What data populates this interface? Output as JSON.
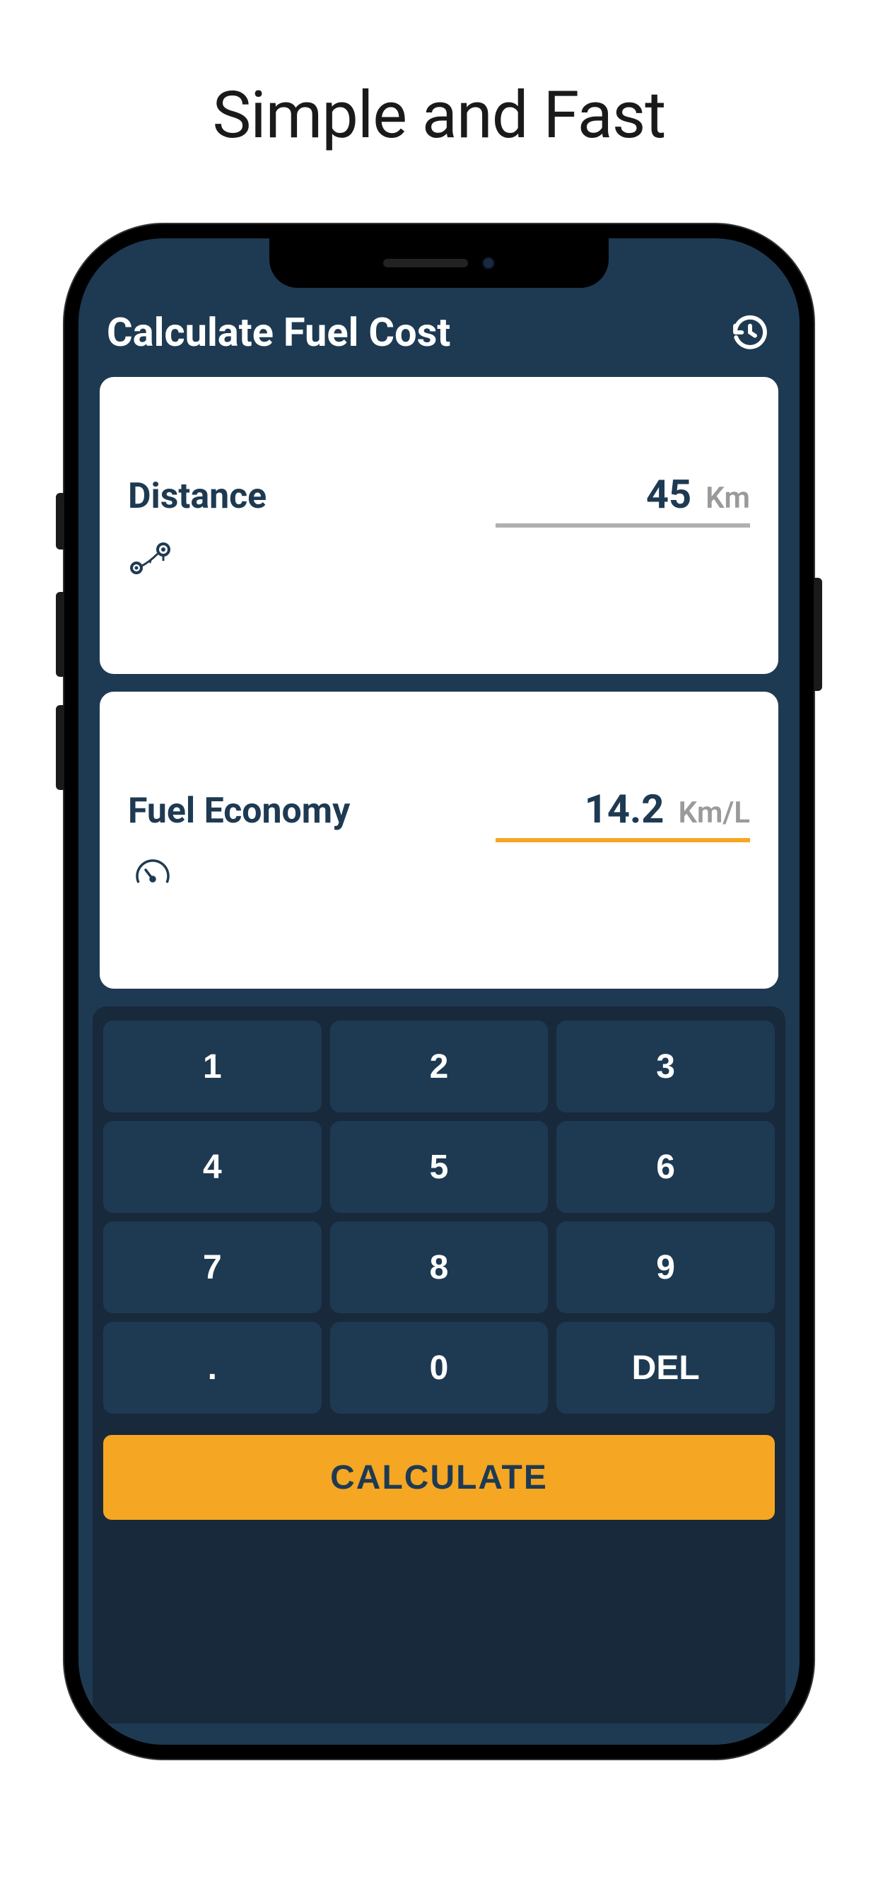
{
  "marketing": {
    "headline": "Simple and Fast"
  },
  "header": {
    "title": "Calculate Fuel Cost"
  },
  "cards": {
    "distance": {
      "label": "Distance",
      "value": "45",
      "unit": "Km"
    },
    "economy": {
      "label": "Fuel Economy",
      "value": "14.2",
      "unit": "Km/L"
    }
  },
  "keypad": {
    "keys": [
      "1",
      "2",
      "3",
      "4",
      "5",
      "6",
      "7",
      "8",
      "9",
      ".",
      "0",
      "DEL"
    ]
  },
  "actions": {
    "calculate": "CALCULATE"
  }
}
